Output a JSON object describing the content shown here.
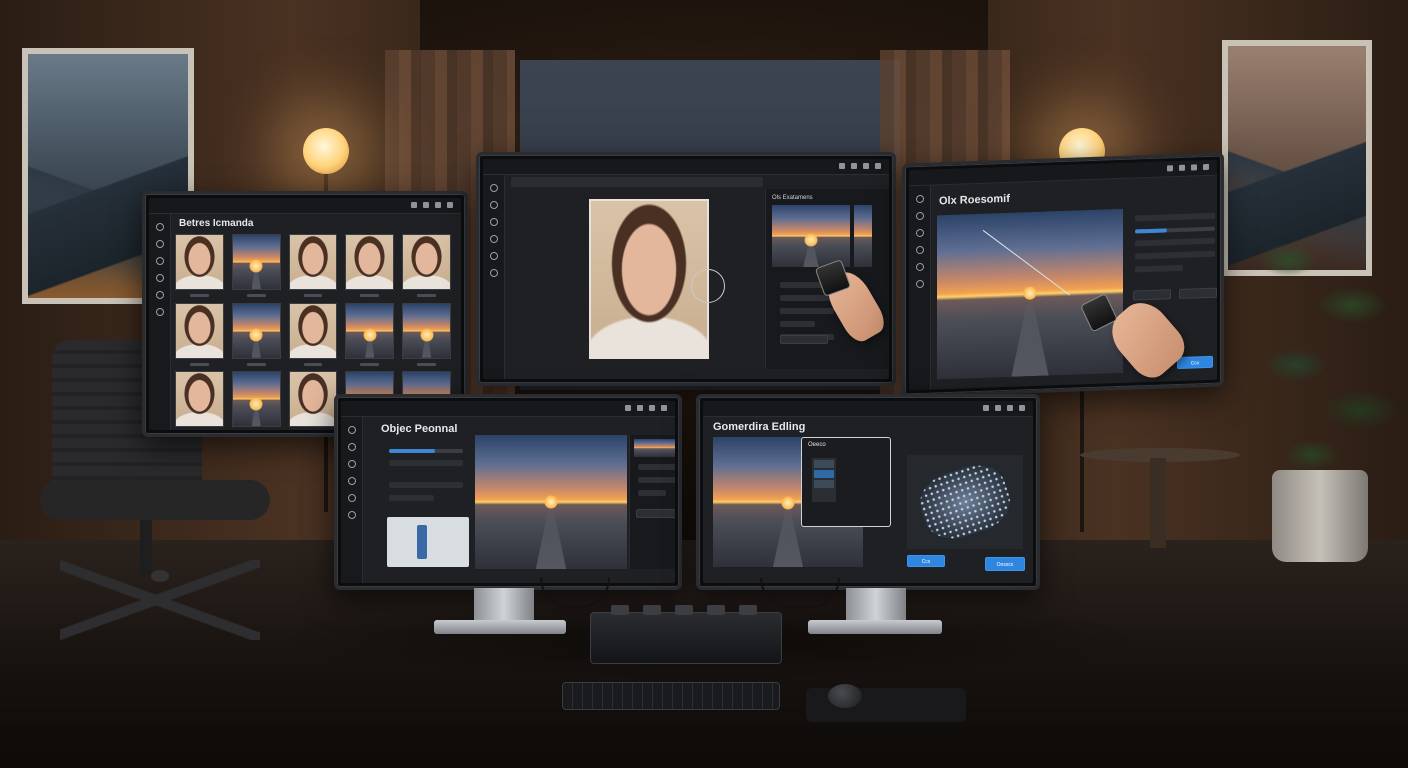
{
  "scene": {
    "description_colors": {
      "accent": "#2f86e0",
      "screen_bg": "#1e2024",
      "wall": "#4a3222"
    }
  },
  "monitors": {
    "batch": {
      "title": "Betres Icmanda",
      "thumbnails": [
        "portrait",
        "sunset",
        "portrait",
        "portrait",
        "portrait",
        "portrait",
        "sunset",
        "portrait",
        "sunset",
        "sunset",
        "portrait",
        "sunset",
        "portrait",
        "sunset",
        "sunset"
      ]
    },
    "center": {
      "panel_heading": "Ols Exatamens"
    },
    "object_right": {
      "title": "Olx Roesomif",
      "apply_label": "Ccx"
    },
    "object_removal": {
      "title": "Objec Peonnal"
    },
    "generative": {
      "title": "Gomerdira Edling",
      "dialog_title": "Oeeco",
      "button_left": "Ccx",
      "button_right": "Oosscx"
    }
  }
}
